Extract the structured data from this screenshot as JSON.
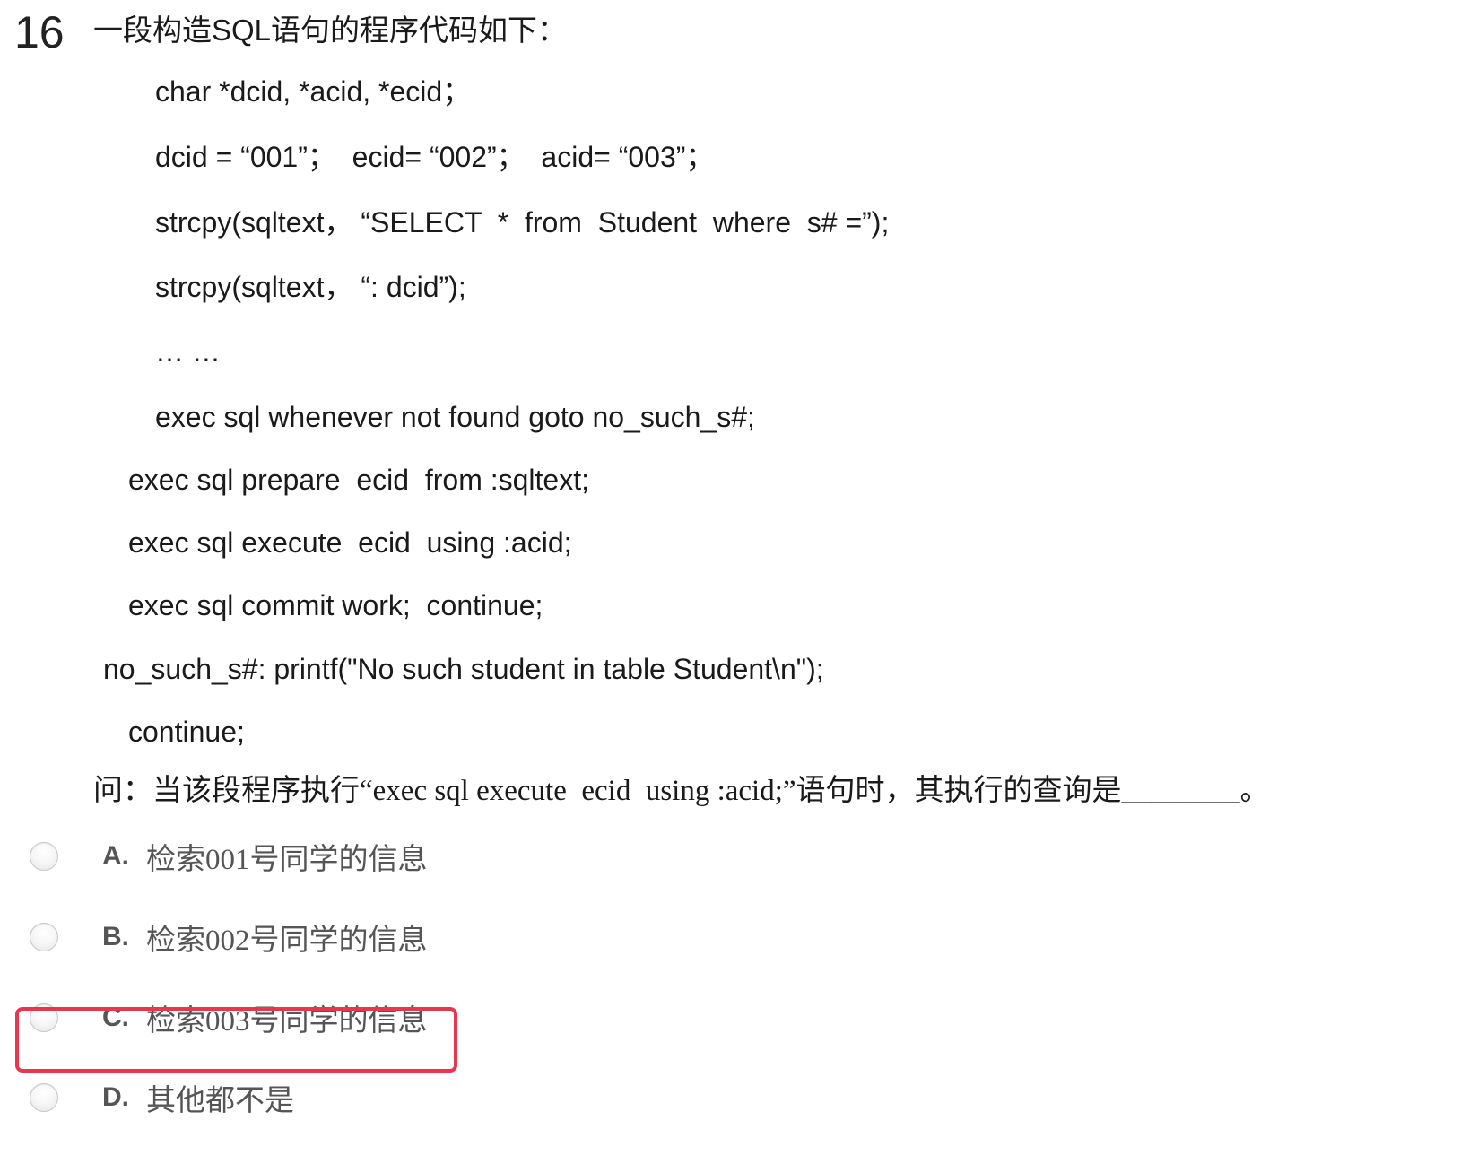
{
  "question": {
    "number": "16",
    "title": "一段构造SQL语句的程序代码如下：",
    "code_lines": [
      "char *dcid, *acid, *ecid；",
      "dcid = “001”；  ecid= “002”；  acid= “003”；",
      "strcpy(sqltext， “SELECT  *  from  Student  where  s# =”);",
      "strcpy(sqltext， “: dcid”);",
      "… …",
      "exec sql whenever not found goto no_such_s#;",
      "exec sql prepare  ecid  from :sqltext;",
      "exec sql execute  ecid  using :acid;",
      "exec sql commit work;  continue;",
      "no_such_s#: printf(\"No such student in table Student\\n\");",
      "continue;"
    ],
    "prompt": "问：当该段程序执行“exec sql execute  ecid  using :acid;”语句时，其执行的查询是________。"
  },
  "options": [
    {
      "letter": "A.",
      "text": "检索001号同学的信息"
    },
    {
      "letter": "B.",
      "text": "检索002号同学的信息"
    },
    {
      "letter": "C.",
      "text": "检索003号同学的信息"
    },
    {
      "letter": "D.",
      "text": "其他都不是"
    }
  ],
  "highlight_color": "#e8364f"
}
